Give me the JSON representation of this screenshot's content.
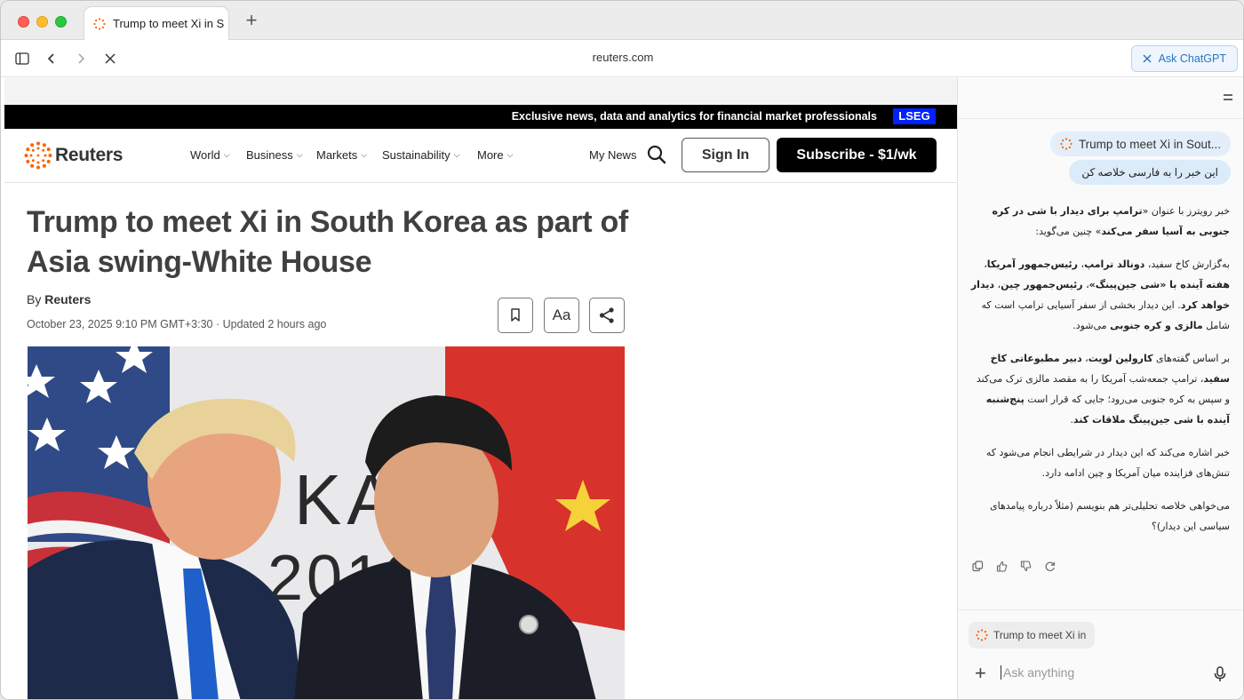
{
  "browser": {
    "tab_title": "Trump to meet Xi in S",
    "url": "reuters.com",
    "ask_chatgpt_label": "Ask ChatGPT"
  },
  "site": {
    "promo_text": "Exclusive news, data and analytics for financial market professionals",
    "promo_badge": "LSEG",
    "logo_text": "Reuters",
    "nav": [
      "World",
      "Business",
      "Markets",
      "Sustainability",
      "More"
    ],
    "my_news": "My News",
    "sign_in": "Sign In",
    "subscribe": "Subscribe - $1/wk"
  },
  "article": {
    "headline": "Trump to meet Xi in South Korea as part of Asia swing-White House",
    "byline_prefix": "By",
    "byline_author": "Reuters",
    "dateline": "October 23, 2025 9:10 PM GMT+3:30 · Updated 2 hours ago",
    "font_button_label": "Aa"
  },
  "sidebar": {
    "reference_chip": "Trump to meet Xi in Sout...",
    "user_message": "این خبر را به فارسی خلاصه کن",
    "answer_paragraphs": [
      [
        {
          "t": "خبر رویترز با عنوان «"
        },
        {
          "t": "ترامپ برای دیدار با شی در کره جنوبی به آسیا سفر می‌کند",
          "b": true
        },
        {
          "t": "» چنین می‌گوید:"
        }
      ],
      [
        {
          "t": "به‌گزارش کاخ سفید، "
        },
        {
          "t": "دونالد ترامپ",
          "b": true
        },
        {
          "t": "، "
        },
        {
          "t": "رئیس‌جمهور آمریکا",
          "b": true
        },
        {
          "t": "، "
        },
        {
          "t": "هفته آینده با «شی جین‌پینگ»",
          "b": true
        },
        {
          "t": "، "
        },
        {
          "t": "رئیس‌جمهور چین",
          "b": true
        },
        {
          "t": "، "
        },
        {
          "t": "دیدار خواهد کرد",
          "b": true
        },
        {
          "t": ". این دیدار بخشی از سفر آسیایی ترامپ است که شامل "
        },
        {
          "t": "مالزی و کره جنوبی",
          "b": true
        },
        {
          "t": " می‌شود."
        }
      ],
      [
        {
          "t": "بر اساس گفته‌های "
        },
        {
          "t": "کارولین لویت",
          "b": true
        },
        {
          "t": "، "
        },
        {
          "t": "دبیر مطبوعاتی کاخ سفید",
          "b": true
        },
        {
          "t": "، ترامپ جمعه‌شب آمریکا را به مقصد مالزی ترک می‌کند و سپس به کره جنوبی می‌رود؛ جایی که قرار است "
        },
        {
          "t": "پنج‌شنبه آینده با شی جین‌پینگ ملاقات کند",
          "b": true
        },
        {
          "t": "."
        }
      ],
      [
        {
          "t": "خبر اشاره می‌کند که این دیدار در شرایطی انجام می‌شود که تنش‌های فزاینده میان آمریکا و چین ادامه دارد."
        }
      ],
      [
        {
          "t": "می‌خواهی خلاصه تحلیلی‌تر هم بنویسم (مثلاً درباره پیامدهای سیاسی این دیدار)؟"
        }
      ]
    ],
    "context_chip": "Trump to meet Xi in",
    "input_placeholder": "Ask anything"
  },
  "colors": {
    "reuters_orange": "#fa6400",
    "lseg_blue": "#0022ff",
    "chatgpt_blue": "#2a76c6"
  }
}
